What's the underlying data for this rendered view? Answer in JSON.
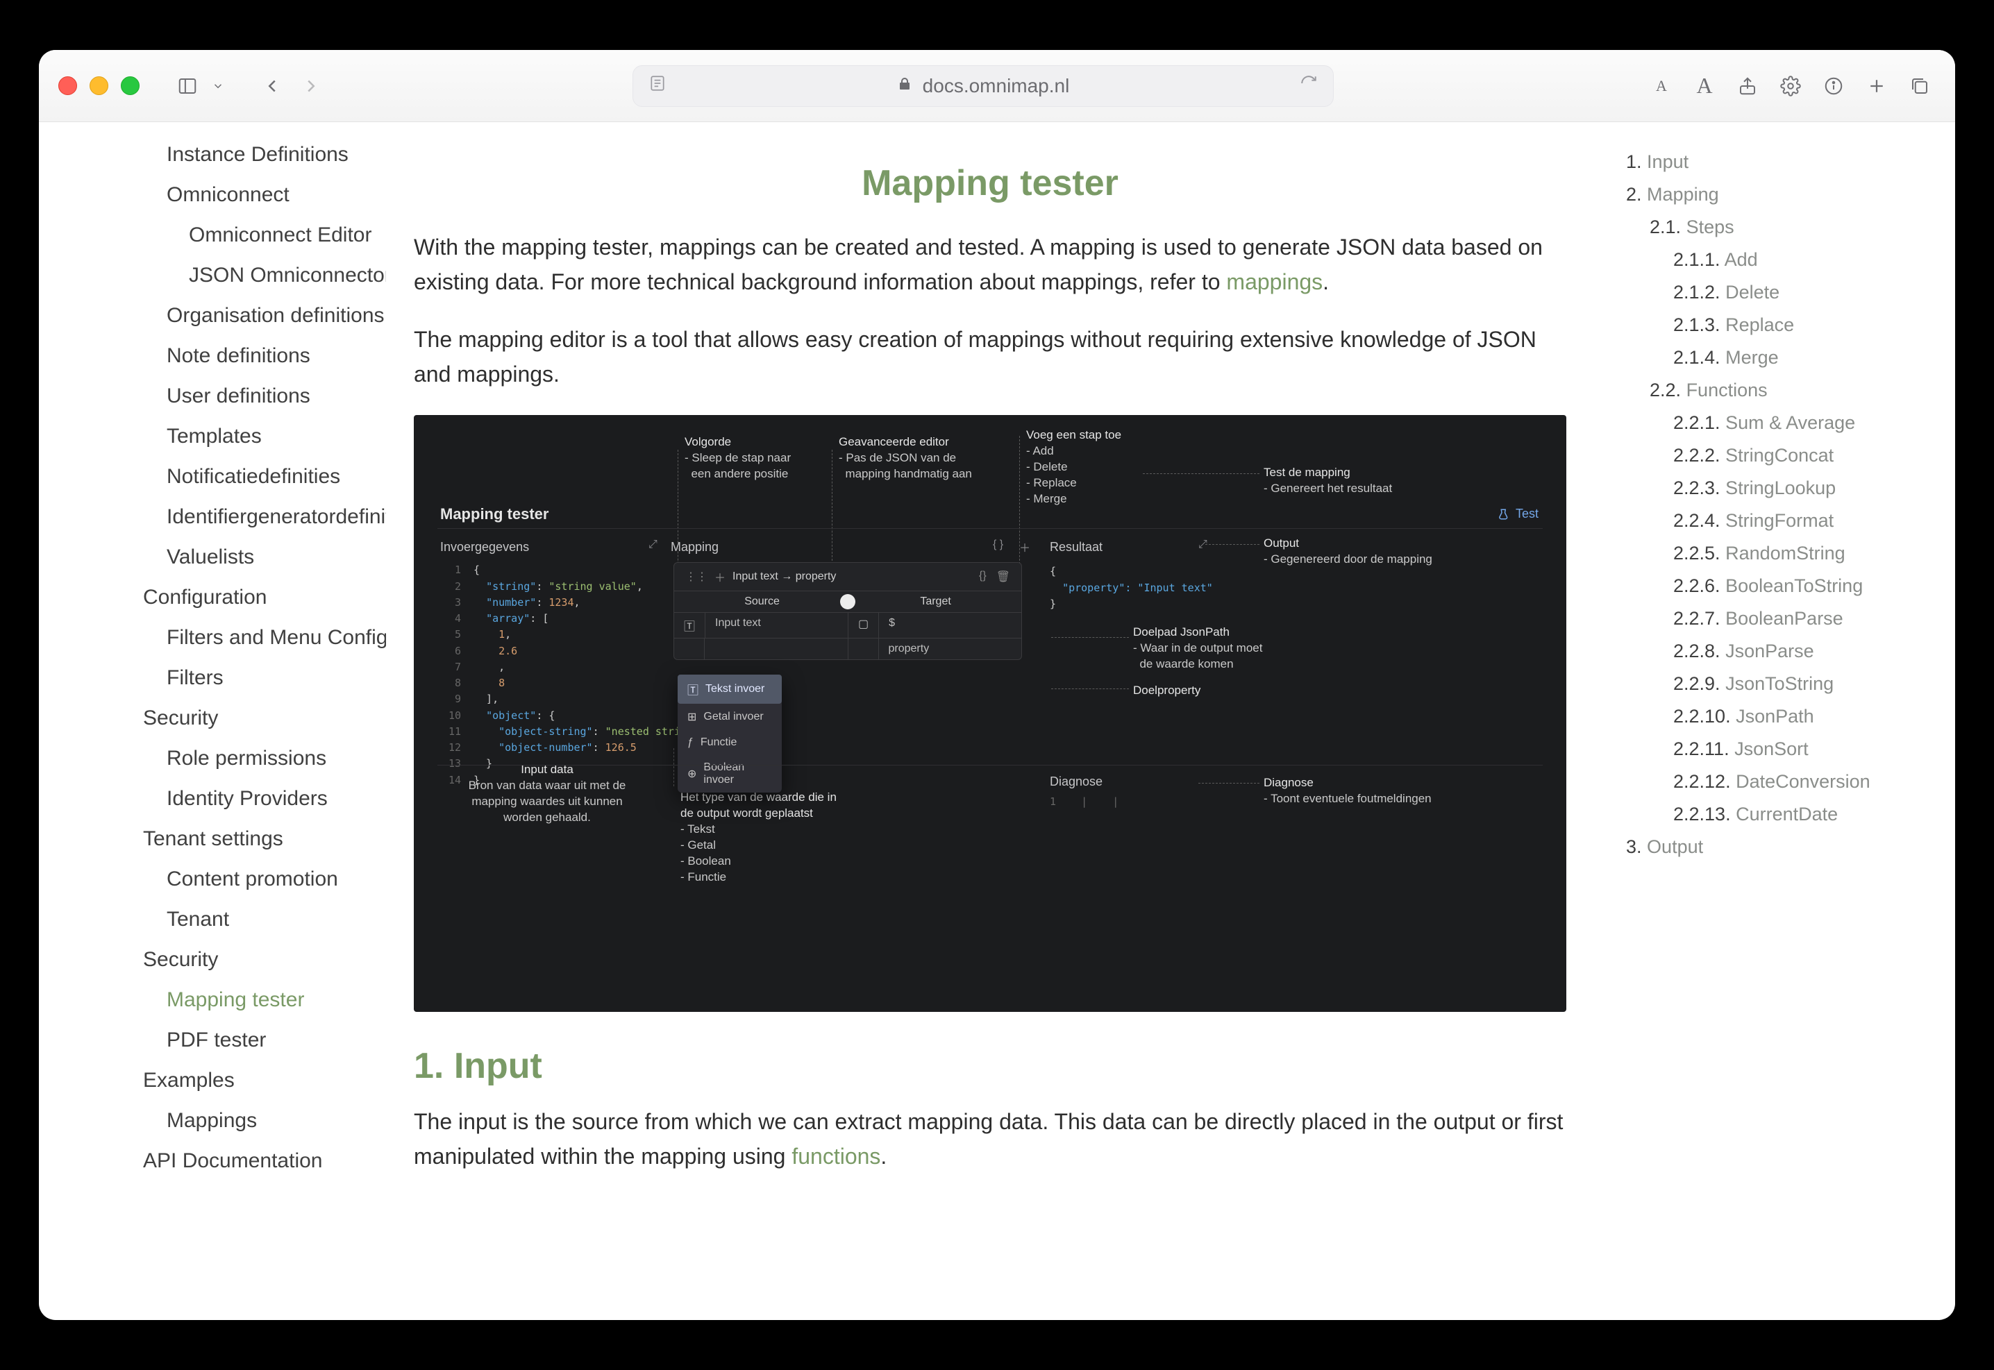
{
  "browser": {
    "url": "docs.omnimap.nl",
    "reader_a1": "A",
    "reader_a2": "A"
  },
  "sidebar": {
    "items": [
      {
        "level": 1,
        "label": "Instance Definitions"
      },
      {
        "level": 1,
        "label": "Omniconnect"
      },
      {
        "level": 2,
        "label": "Omniconnect Editor"
      },
      {
        "level": 2,
        "label": "JSON Omniconnector"
      },
      {
        "level": 1,
        "label": "Organisation definitions"
      },
      {
        "level": 1,
        "label": "Note definitions"
      },
      {
        "level": 1,
        "label": "User definitions"
      },
      {
        "level": 1,
        "label": "Templates"
      },
      {
        "level": 1,
        "label": "Notificatiedefinities"
      },
      {
        "level": 1,
        "label": "Identifiergeneratordefinitions"
      },
      {
        "level": 1,
        "label": "Valuelists"
      },
      {
        "level": 0,
        "label": "Configuration"
      },
      {
        "level": 1,
        "label": "Filters and Menu Configuration"
      },
      {
        "level": 1,
        "label": "Filters"
      },
      {
        "level": 0,
        "label": "Security"
      },
      {
        "level": 1,
        "label": "Role permissions"
      },
      {
        "level": 1,
        "label": "Identity Providers"
      },
      {
        "level": 0,
        "label": "Tenant settings"
      },
      {
        "level": 1,
        "label": "Content promotion"
      },
      {
        "level": 1,
        "label": "Tenant"
      },
      {
        "level": 0,
        "label": "Security"
      },
      {
        "level": 1,
        "label": "Mapping tester",
        "active": true
      },
      {
        "level": 1,
        "label": "PDF tester"
      },
      {
        "level": 0,
        "label": "Examples"
      },
      {
        "level": 1,
        "label": "Mappings"
      },
      {
        "level": 0,
        "label": "API Documentation"
      }
    ]
  },
  "main": {
    "title": "Mapping tester",
    "intro_a": "With the mapping tester, mappings can be created and tested. A mapping is used to generate JSON data based on existing data. For more technical background information about mappings, refer to ",
    "intro_link": "mappings",
    "intro_b": ".",
    "para2": "The mapping editor is a tool that allows easy creation of mappings without requiring extensive knowledge of JSON and mappings.",
    "section1_title": "1. Input",
    "section1_body_a": "The input is the source from which we can extract mapping data. This data can be directly placed in the output or first manipulated within the mapping using ",
    "section1_link": "functions",
    "section1_body_b": "."
  },
  "screenshot": {
    "title": "Mapping tester",
    "test_label": "Test",
    "panel_input": "Invoergegevens",
    "panel_mapping": "Mapping",
    "panel_result": "Resultaat",
    "panel_diagnose": "Diagnose",
    "map_head": "Input text → property",
    "source_label": "Source",
    "target_label": "Target",
    "row_source_val": "Input text",
    "row_target_val": "$",
    "row2_target": "property",
    "dropdown": {
      "opt1": "Tekst invoer",
      "opt2": "Getal invoer",
      "opt3": "Functie",
      "opt4": "Boolean invoer"
    },
    "callouts": {
      "volgorde_t": "Volgorde",
      "volgorde_b": "- Sleep de stap naar\n  een andere positie",
      "adv_t": "Geavanceerde editor",
      "adv_b": "- Pas de JSON van de\n  mapping handmatig aan",
      "add_t": "Voeg een stap toe",
      "add_b": "- Add\n- Delete\n- Replace\n- Merge",
      "test_t": "Test de mapping",
      "test_b": "- Genereert het resultaat",
      "output_t": "Output",
      "output_b": "- Gegenereerd door de mapping",
      "doelpad_t": "Doelpad JsonPath",
      "doelpad_b": "- Waar in de output moet\n  de waarde komen",
      "doelprop_t": "Doelproperty",
      "type_t": "Het type van de waarde die in\nde output wordt geplaatst",
      "type_b": "- Tekst\n- Getal\n- Boolean\n- Functie",
      "input_t": "Input data",
      "input_b": "Bron van data waar uit met de\nmapping waardes uit kunnen\nworden gehaald.",
      "diag_t": "Diagnose",
      "diag_b": "- Toont eventuele foutmeldingen"
    },
    "result_json": "\"property\": \"Input text\"",
    "input_json": {
      "l1": "{",
      "l2": "  \"string\": \"string value\",",
      "l3": "  \"number\": 1234,",
      "l4": "  \"array\": [",
      "l5": "    1,",
      "l6": "    2.6",
      "l7": "    ,",
      "l8": "    8",
      "l9": "  ],",
      "l10": "  \"object\": {",
      "l11": "    \"object-string\": \"nested strin",
      "l12": "    \"object-number\": 126.5",
      "l13": "  }",
      "l14": "}"
    }
  },
  "toc": {
    "items": [
      {
        "level": 0,
        "num": "1.",
        "label": "Input"
      },
      {
        "level": 0,
        "num": "2.",
        "label": "Mapping"
      },
      {
        "level": 1,
        "num": "2.1.",
        "label": "Steps"
      },
      {
        "level": 2,
        "num": "2.1.1.",
        "label": "Add"
      },
      {
        "level": 2,
        "num": "2.1.2.",
        "label": "Delete"
      },
      {
        "level": 2,
        "num": "2.1.3.",
        "label": "Replace"
      },
      {
        "level": 2,
        "num": "2.1.4.",
        "label": "Merge"
      },
      {
        "level": 1,
        "num": "2.2.",
        "label": "Functions"
      },
      {
        "level": 2,
        "num": "2.2.1.",
        "label": "Sum & Average"
      },
      {
        "level": 2,
        "num": "2.2.2.",
        "label": "StringConcat"
      },
      {
        "level": 2,
        "num": "2.2.3.",
        "label": "StringLookup"
      },
      {
        "level": 2,
        "num": "2.2.4.",
        "label": "StringFormat"
      },
      {
        "level": 2,
        "num": "2.2.5.",
        "label": "RandomString"
      },
      {
        "level": 2,
        "num": "2.2.6.",
        "label": "BooleanToString"
      },
      {
        "level": 2,
        "num": "2.2.7.",
        "label": "BooleanParse"
      },
      {
        "level": 2,
        "num": "2.2.8.",
        "label": "JsonParse"
      },
      {
        "level": 2,
        "num": "2.2.9.",
        "label": "JsonToString"
      },
      {
        "level": 2,
        "num": "2.2.10.",
        "label": "JsonPath"
      },
      {
        "level": 2,
        "num": "2.2.11.",
        "label": "JsonSort"
      },
      {
        "level": 2,
        "num": "2.2.12.",
        "label": "DateConversion"
      },
      {
        "level": 2,
        "num": "2.2.13.",
        "label": "CurrentDate"
      },
      {
        "level": 0,
        "num": "3.",
        "label": "Output"
      }
    ]
  }
}
